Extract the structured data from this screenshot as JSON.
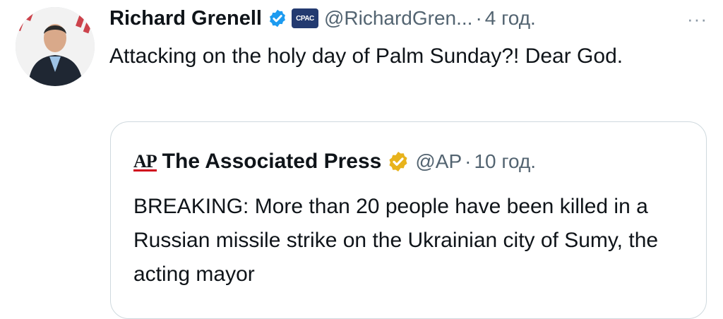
{
  "tweet": {
    "author": {
      "display_name": "Richard Grenell",
      "handle": "@RichardGren...",
      "verified_badge": "blue-check-icon",
      "affiliate_badge": "CPAC"
    },
    "separator": "·",
    "timestamp": "4 год.",
    "more_icon": "···",
    "text": "Attacking on the holy day of Palm Sunday?! Dear God."
  },
  "quote": {
    "logo_text": "AP",
    "display_name": "The Associated Press",
    "handle": "@AP",
    "verified_badge": "gold-check-icon",
    "separator": "·",
    "timestamp": "10 год.",
    "text": "BREAKING: More than 20 people have been killed in a Russian missile strike on the Ukrainian city of Sumy, the acting mayor"
  },
  "colors": {
    "primary_text": "#0f1419",
    "secondary_text": "#536471",
    "verified_blue": "#1d9bf0",
    "verified_gold": "#e8b31c",
    "border": "#cfd9de",
    "ap_red": "#d0021b"
  }
}
